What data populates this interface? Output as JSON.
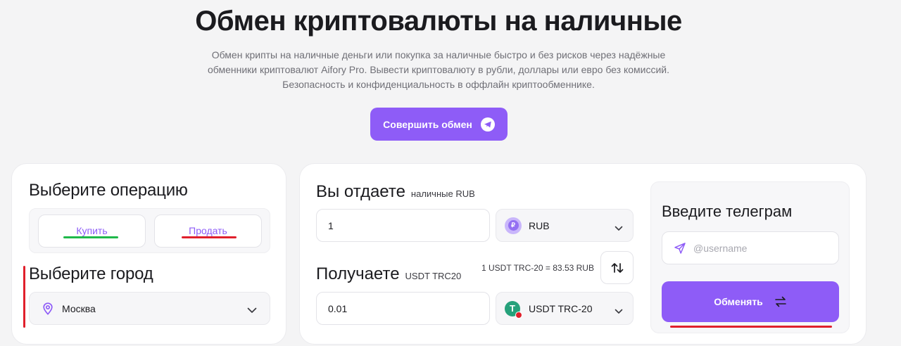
{
  "hero": {
    "title": "Обмен криптовалюты на наличные",
    "description_lines": [
      "Обмен крипты на наличные деньги или покупка за наличные быстро и без рисков через надёжные",
      "обменники криптовалют Aifory Pro. Вывести криптовалюту в рубли, доллары или евро без комиссий.",
      "Безопасность и конфиденциальность в оффлайн криптообменнике."
    ],
    "cta_label": "Совершить обмен"
  },
  "operation": {
    "title": "Выберите операцию",
    "buy_label": "Купить",
    "sell_label": "Продать"
  },
  "city": {
    "title": "Выберите город",
    "selected": "Москва"
  },
  "give": {
    "title": "Вы отдаете",
    "subtitle": "наличные RUB",
    "amount": "1",
    "currency": "RUB"
  },
  "receive": {
    "title": "Получаете",
    "subtitle": "USDT TRC20",
    "rate": "1 USDT TRC-20 = 83.53 RUB",
    "amount": "0.01",
    "currency": "USDT TRC-20"
  },
  "telegram": {
    "title": "Введите телеграм",
    "placeholder": "@username",
    "submit_label": "Обменять"
  },
  "colors": {
    "accent": "#8e5cf7",
    "green_mark": "#1fb84a",
    "red_mark": "#e0202c"
  }
}
